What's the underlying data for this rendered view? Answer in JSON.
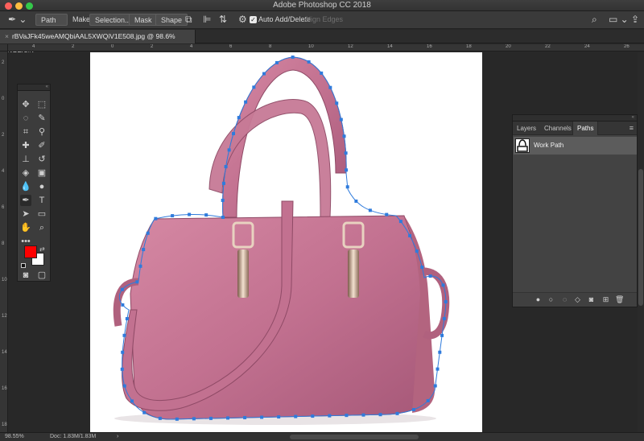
{
  "window": {
    "title": "Adobe Photoshop CC 2018",
    "traffic_colors": [
      "#fc605c",
      "#fdbc40",
      "#34c84a"
    ]
  },
  "options_bar": {
    "tool_mode": "Path",
    "make_label": "Make:",
    "selection_button": "Selection...",
    "mask_button": "Mask",
    "shape_button": "Shape",
    "auto_add_delete_label": "Auto Add/Delete",
    "auto_add_delete_checked": true,
    "align_edges_label": "Align Edges"
  },
  "document_tab": {
    "label": "rBVaJFk45weAMQbiAAL5XWQiV1E508.jpg @ 98.6% (RGB/8#) *"
  },
  "ruler": {
    "h_ticks": [
      "4",
      "2",
      "0",
      "2",
      "4",
      "6",
      "8",
      "10",
      "12",
      "14",
      "16",
      "18",
      "20",
      "22",
      "24",
      "26"
    ],
    "v_ticks": [
      "2",
      "0",
      "2",
      "4",
      "6",
      "8",
      "10",
      "12",
      "14",
      "16",
      "18"
    ]
  },
  "toolbox": {
    "foreground_color": "#ff0000",
    "background_color": "#ffffff"
  },
  "layers_panel": {
    "tabs": [
      "Layers",
      "Channels",
      "Paths"
    ],
    "active_tab": "Paths",
    "path_item": "Work Path"
  },
  "status_bar": {
    "zoom": "98.55%",
    "doc_size": "Doc: 1.83M/1.83M"
  },
  "colors": {
    "accent_path": "#2f7bdc",
    "bag": "#bf6f8c"
  }
}
